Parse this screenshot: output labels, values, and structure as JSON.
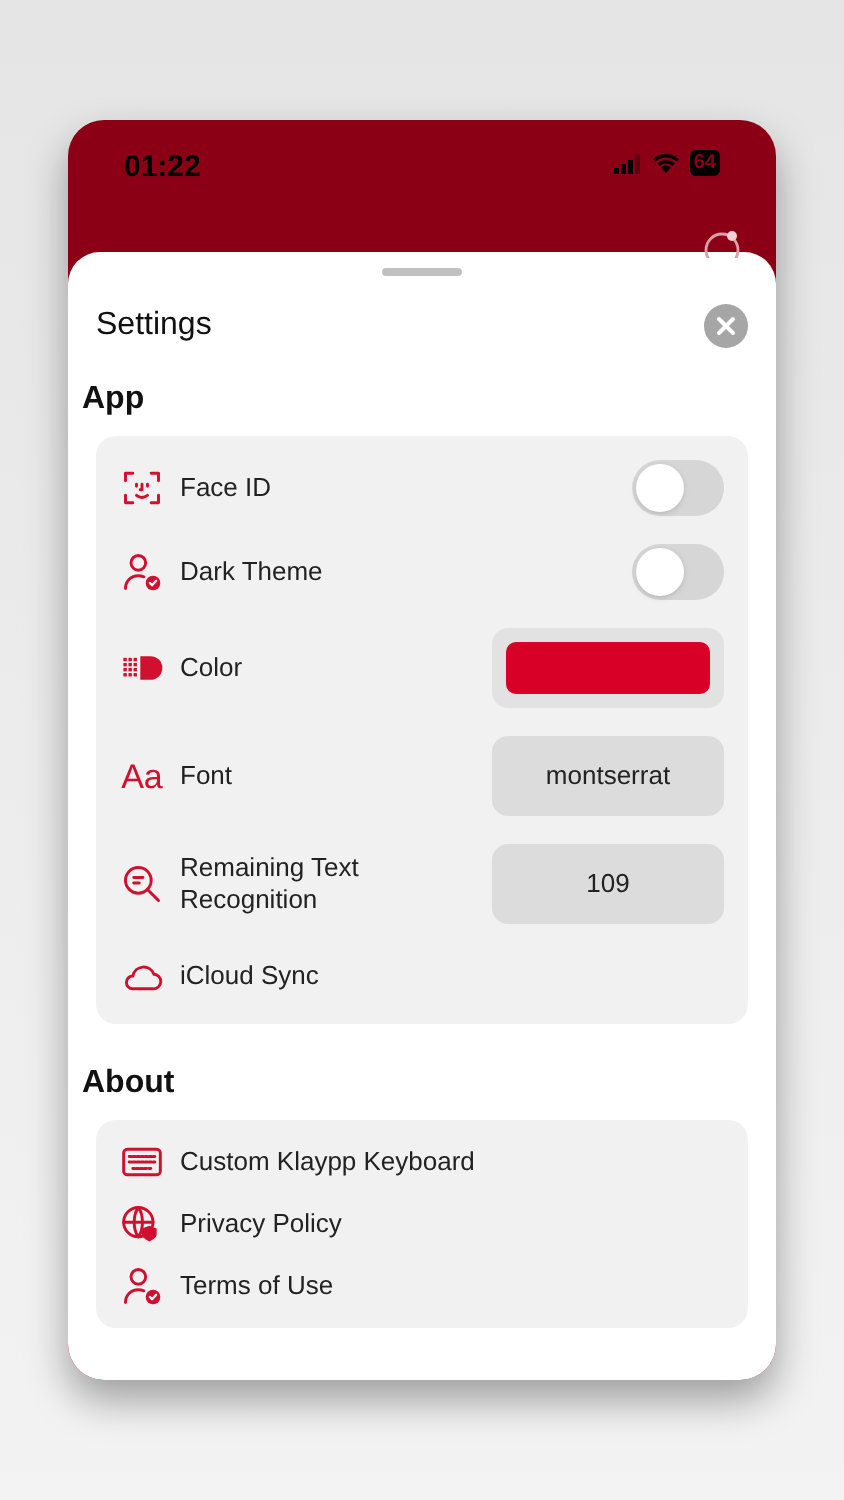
{
  "status_bar": {
    "time": "01:22",
    "battery": "64"
  },
  "sheet": {
    "title": "Settings"
  },
  "sections": [
    {
      "title": "App",
      "items": [
        {
          "kind": "toggle",
          "label": "Face ID",
          "on": false
        },
        {
          "kind": "toggle",
          "label": "Dark Theme",
          "on": false
        },
        {
          "kind": "color",
          "label": "Color",
          "color": "#d80026"
        },
        {
          "kind": "value",
          "label": "Font",
          "value": "montserrat",
          "icon_text": "Aa"
        },
        {
          "kind": "value",
          "label": "Remaining Text Recognition",
          "value": "109"
        },
        {
          "kind": "plain",
          "label": "iCloud Sync"
        }
      ]
    },
    {
      "title": "About",
      "items": [
        {
          "kind": "plain",
          "label": "Custom Klaypp Keyboard"
        },
        {
          "kind": "plain",
          "label": "Privacy Policy"
        },
        {
          "kind": "plain",
          "label": "Terms of Use"
        }
      ]
    }
  ]
}
